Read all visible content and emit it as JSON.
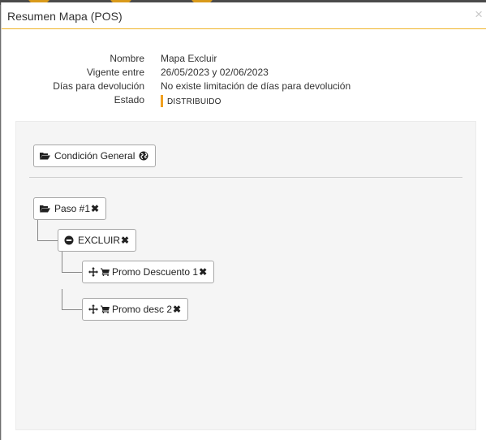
{
  "modal": {
    "title": "Resumen Mapa (POS)",
    "close_symbol": "×"
  },
  "summary": {
    "rows": [
      {
        "label": "Nombre",
        "value": "Mapa Excluir"
      },
      {
        "label": "Vigente entre",
        "value": "26/05/2023 y 02/06/2023"
      },
      {
        "label": "Días para devolución",
        "value": "No existe limitación de días para devolución"
      },
      {
        "label": "Estado",
        "value": "DISTRIBUIDO"
      }
    ],
    "state_color": "#f0a020"
  },
  "tree": {
    "general": {
      "label": "Condición General",
      "icons": [
        "folder-open-icon",
        "globe-icon"
      ]
    },
    "step": {
      "label": "Paso #1",
      "remove": "✖"
    },
    "exclude": {
      "label": "EXCLUIR",
      "remove": "✖"
    },
    "promos": [
      {
        "label": "Promo Descuento 1",
        "remove": "✖"
      },
      {
        "label": "Promo desc 2",
        "remove": "✖"
      }
    ]
  },
  "colors": {
    "accent": "#f0b429",
    "panel_bg": "#f5f5f5"
  }
}
